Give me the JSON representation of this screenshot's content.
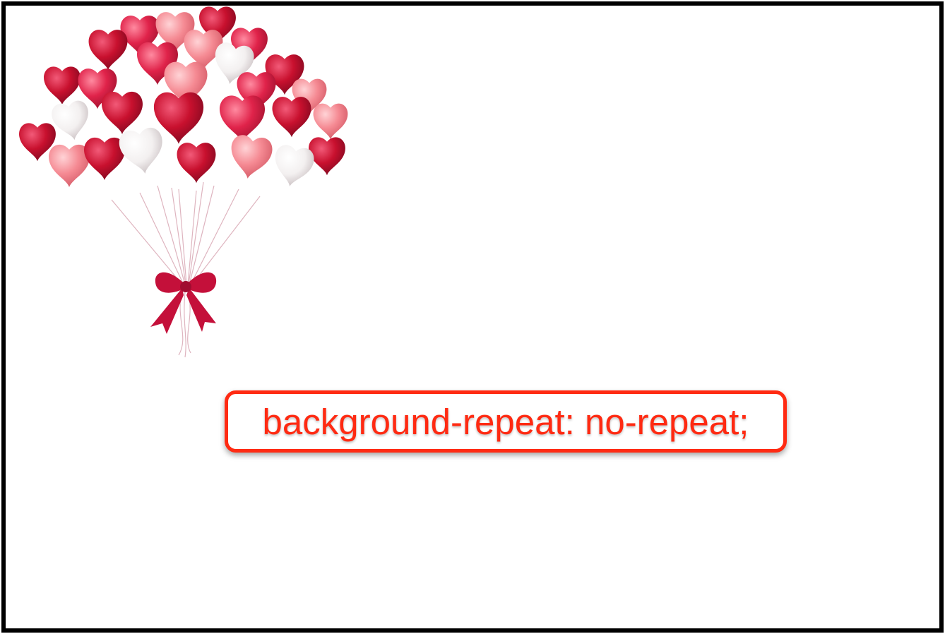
{
  "label": {
    "text": "background-repeat: no-repeat;"
  },
  "image": {
    "subject": "heart-balloon-bouquet",
    "colors": {
      "dark_red": "#c8102e",
      "red": "#e0234a",
      "pink": "#f58a93",
      "white": "#f3f0f0",
      "ribbon": "#c4103a"
    }
  },
  "colors": {
    "frame": "#000000",
    "accent": "#ff2a12",
    "background": "#ffffff"
  }
}
